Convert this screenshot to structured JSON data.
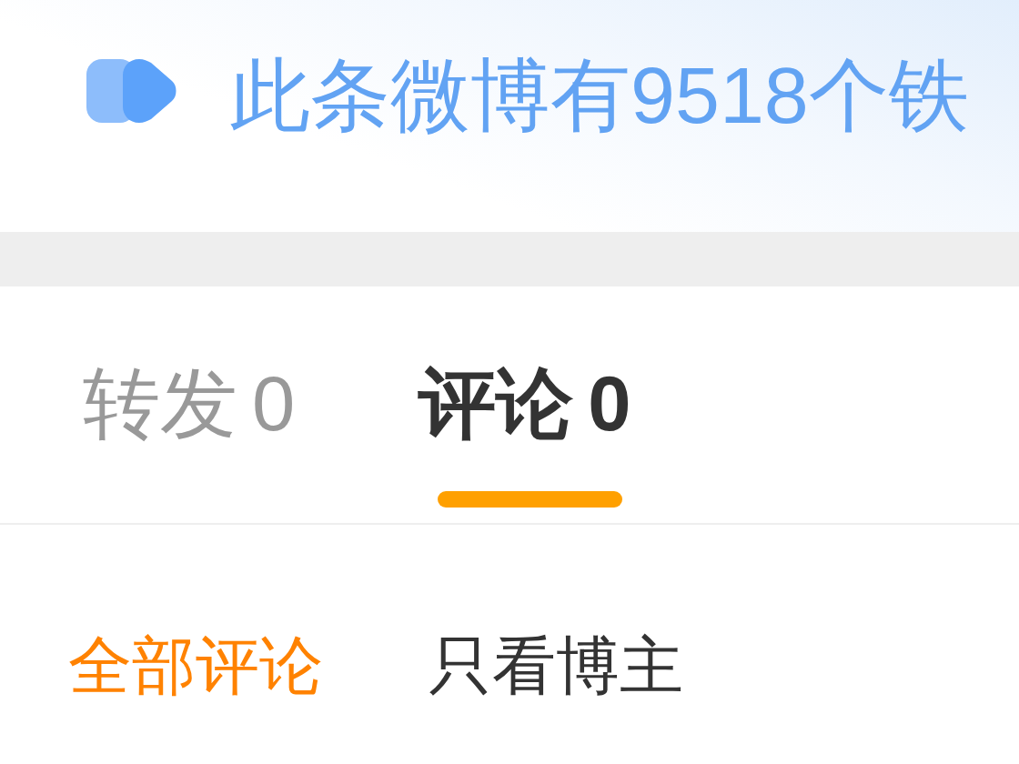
{
  "banner": {
    "text": "此条微博有9518个铁"
  },
  "tabs": [
    {
      "label": "转发",
      "count": "0",
      "selected": false
    },
    {
      "label": "评论",
      "count": "0",
      "selected": true
    }
  ],
  "filters": [
    {
      "label": "全部评论",
      "selected": true
    },
    {
      "label": "只看博主",
      "selected": false
    }
  ]
}
